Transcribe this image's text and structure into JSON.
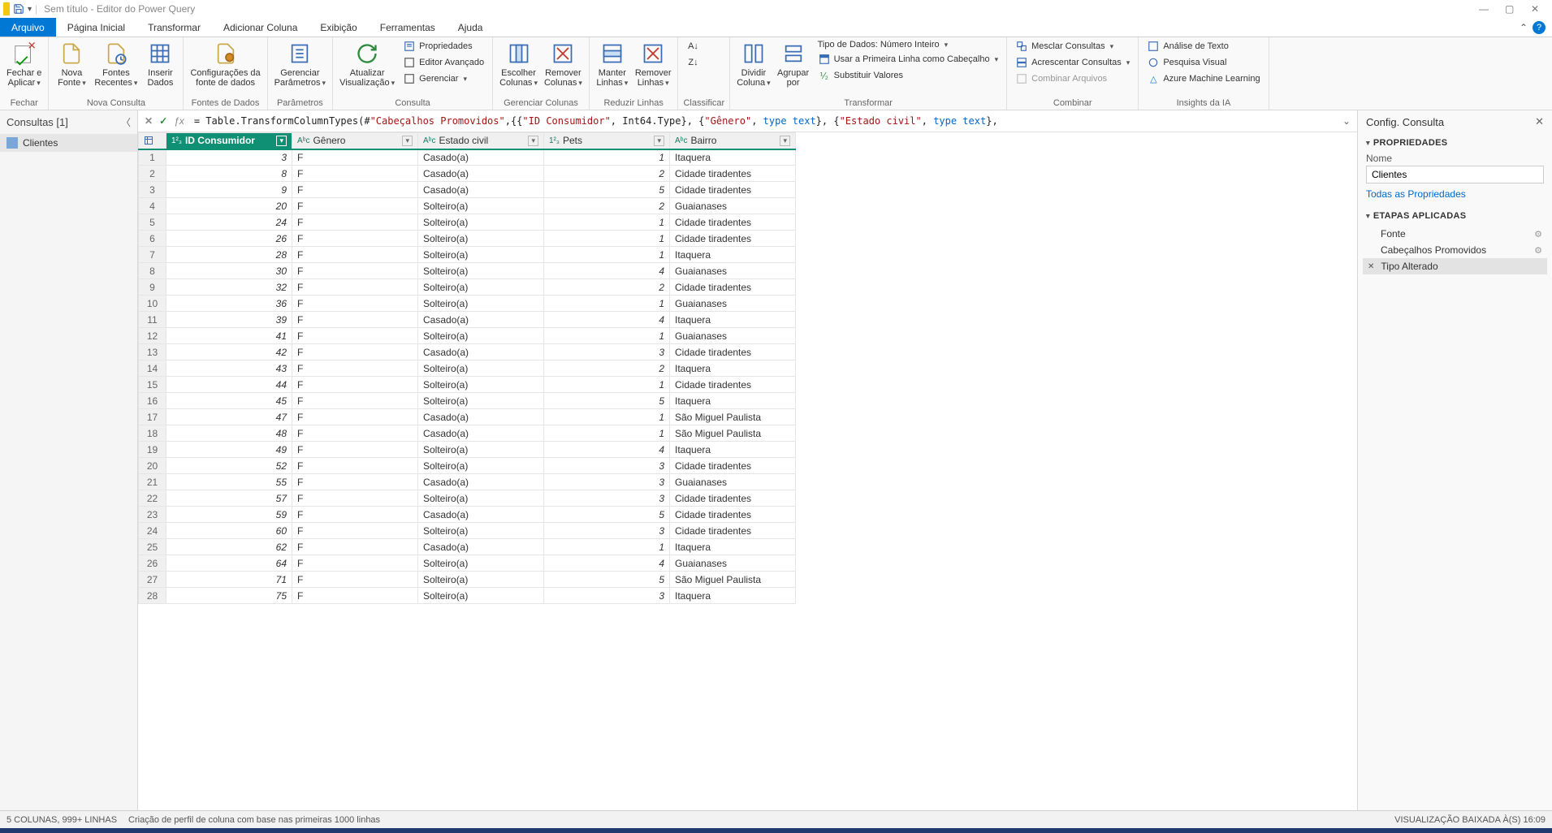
{
  "titlebar": {
    "title": "Sem título - Editor do Power Query"
  },
  "tabs": [
    "Arquivo",
    "Página Inicial",
    "Transformar",
    "Adicionar Coluna",
    "Exibição",
    "Ferramentas",
    "Ajuda"
  ],
  "ribbon": {
    "fechar": {
      "close_apply": "Fechar e\nAplicar",
      "group": "Fechar"
    },
    "nova": {
      "nova_fonte": "Nova\nFonte",
      "fontes_recentes": "Fontes\nRecentes",
      "inserir_dados": "Inserir\nDados",
      "group": "Nova Consulta"
    },
    "fontes": {
      "config": "Configurações da\nfonte de dados",
      "group": "Fontes de Dados"
    },
    "parametros": {
      "gerenciar": "Gerenciar\nParâmetros",
      "group": "Parâmetros"
    },
    "consulta": {
      "atualizar": "Atualizar\nVisualização",
      "props": "Propriedades",
      "editor": "Editor Avançado",
      "ger": "Gerenciar",
      "group": "Consulta"
    },
    "ger_col": {
      "escolher": "Escolher\nColunas",
      "remover": "Remover\nColunas",
      "group": "Gerenciar Colunas"
    },
    "red_lin": {
      "manter": "Manter\nLinhas",
      "remover": "Remover\nLinhas",
      "group": "Reduzir Linhas"
    },
    "classificar": {
      "group": "Classificar"
    },
    "split": {
      "dividir": "Dividir\nColuna",
      "agrupar": "Agrupar\npor"
    },
    "transformar": {
      "tipo": "Tipo de Dados: Número Inteiro",
      "cabecalho": "Usar a Primeira Linha como Cabeçalho",
      "subs": "Substituir Valores",
      "group": "Transformar"
    },
    "combinar": {
      "mesclar": "Mesclar Consultas",
      "acrescentar": "Acrescentar Consultas",
      "arquivos": "Combinar Arquivos",
      "group": "Combinar"
    },
    "ia": {
      "texto": "Análise de Texto",
      "visual": "Pesquisa Visual",
      "azure": "Azure Machine Learning",
      "group": "Insights da IA"
    }
  },
  "queries": {
    "title": "Consultas [1]",
    "item": "Clientes"
  },
  "formula": {
    "prefix": "= Table.TransformColumnTypes(#",
    "s1": "\"Cabeçalhos Promovidos\"",
    "mid1": ",{{",
    "s2": "\"ID Consumidor\"",
    "mid2": ", Int64.Type}, {",
    "s3": "\"Gênero\"",
    "mid3": ", ",
    "kw1": "type text",
    "mid4": "}, {",
    "s4": "\"Estado civil\"",
    "mid5": ", ",
    "kw2": "type text",
    "end": "},"
  },
  "columns": [
    "ID Consumidor",
    "Gênero",
    "Estado civil",
    "Pets",
    "Bairro"
  ],
  "rows": [
    {
      "n": 1,
      "id": "3",
      "g": "F",
      "ec": "Casado(a)",
      "p": "1",
      "b": "Itaquera"
    },
    {
      "n": 2,
      "id": "8",
      "g": "F",
      "ec": "Casado(a)",
      "p": "2",
      "b": "Cidade tiradentes"
    },
    {
      "n": 3,
      "id": "9",
      "g": "F",
      "ec": "Casado(a)",
      "p": "5",
      "b": "Cidade tiradentes"
    },
    {
      "n": 4,
      "id": "20",
      "g": "F",
      "ec": "Solteiro(a)",
      "p": "2",
      "b": "Guaianases"
    },
    {
      "n": 5,
      "id": "24",
      "g": "F",
      "ec": "Solteiro(a)",
      "p": "1",
      "b": "Cidade tiradentes"
    },
    {
      "n": 6,
      "id": "26",
      "g": "F",
      "ec": "Solteiro(a)",
      "p": "1",
      "b": "Cidade tiradentes"
    },
    {
      "n": 7,
      "id": "28",
      "g": "F",
      "ec": "Solteiro(a)",
      "p": "1",
      "b": "Itaquera"
    },
    {
      "n": 8,
      "id": "30",
      "g": "F",
      "ec": "Solteiro(a)",
      "p": "4",
      "b": "Guaianases"
    },
    {
      "n": 9,
      "id": "32",
      "g": "F",
      "ec": "Solteiro(a)",
      "p": "2",
      "b": "Cidade tiradentes"
    },
    {
      "n": 10,
      "id": "36",
      "g": "F",
      "ec": "Solteiro(a)",
      "p": "1",
      "b": "Guaianases"
    },
    {
      "n": 11,
      "id": "39",
      "g": "F",
      "ec": "Casado(a)",
      "p": "4",
      "b": "Itaquera"
    },
    {
      "n": 12,
      "id": "41",
      "g": "F",
      "ec": "Solteiro(a)",
      "p": "1",
      "b": "Guaianases"
    },
    {
      "n": 13,
      "id": "42",
      "g": "F",
      "ec": "Casado(a)",
      "p": "3",
      "b": "Cidade tiradentes"
    },
    {
      "n": 14,
      "id": "43",
      "g": "F",
      "ec": "Solteiro(a)",
      "p": "2",
      "b": "Itaquera"
    },
    {
      "n": 15,
      "id": "44",
      "g": "F",
      "ec": "Solteiro(a)",
      "p": "1",
      "b": "Cidade tiradentes"
    },
    {
      "n": 16,
      "id": "45",
      "g": "F",
      "ec": "Solteiro(a)",
      "p": "5",
      "b": "Itaquera"
    },
    {
      "n": 17,
      "id": "47",
      "g": "F",
      "ec": "Casado(a)",
      "p": "1",
      "b": "São Miguel Paulista"
    },
    {
      "n": 18,
      "id": "48",
      "g": "F",
      "ec": "Casado(a)",
      "p": "1",
      "b": "São Miguel Paulista"
    },
    {
      "n": 19,
      "id": "49",
      "g": "F",
      "ec": "Solteiro(a)",
      "p": "4",
      "b": "Itaquera"
    },
    {
      "n": 20,
      "id": "52",
      "g": "F",
      "ec": "Solteiro(a)",
      "p": "3",
      "b": "Cidade tiradentes"
    },
    {
      "n": 21,
      "id": "55",
      "g": "F",
      "ec": "Casado(a)",
      "p": "3",
      "b": "Guaianases"
    },
    {
      "n": 22,
      "id": "57",
      "g": "F",
      "ec": "Solteiro(a)",
      "p": "3",
      "b": "Cidade tiradentes"
    },
    {
      "n": 23,
      "id": "59",
      "g": "F",
      "ec": "Casado(a)",
      "p": "5",
      "b": "Cidade tiradentes"
    },
    {
      "n": 24,
      "id": "60",
      "g": "F",
      "ec": "Solteiro(a)",
      "p": "3",
      "b": "Cidade tiradentes"
    },
    {
      "n": 25,
      "id": "62",
      "g": "F",
      "ec": "Casado(a)",
      "p": "1",
      "b": "Itaquera"
    },
    {
      "n": 26,
      "id": "64",
      "g": "F",
      "ec": "Solteiro(a)",
      "p": "4",
      "b": "Guaianases"
    },
    {
      "n": 27,
      "id": "71",
      "g": "F",
      "ec": "Solteiro(a)",
      "p": "5",
      "b": "São Miguel Paulista"
    },
    {
      "n": 28,
      "id": "75",
      "g": "F",
      "ec": "Solteiro(a)",
      "p": "3",
      "b": "Itaquera"
    }
  ],
  "props": {
    "panel_title": "Config. Consulta",
    "sect_props": "PROPRIEDADES",
    "name_label": "Nome",
    "name_value": "Clientes",
    "all_props": "Todas as Propriedades",
    "sect_steps": "ETAPAS APLICADAS",
    "steps": [
      "Fonte",
      "Cabeçalhos Promovidos",
      "Tipo Alterado"
    ]
  },
  "status": {
    "cols": "5 COLUNAS, 999+ LINHAS",
    "profile": "Criação de perfil de coluna com base nas primeiras 1000 linhas",
    "right": "VISUALIZAÇÃO BAIXADA À(S) 16:09"
  }
}
